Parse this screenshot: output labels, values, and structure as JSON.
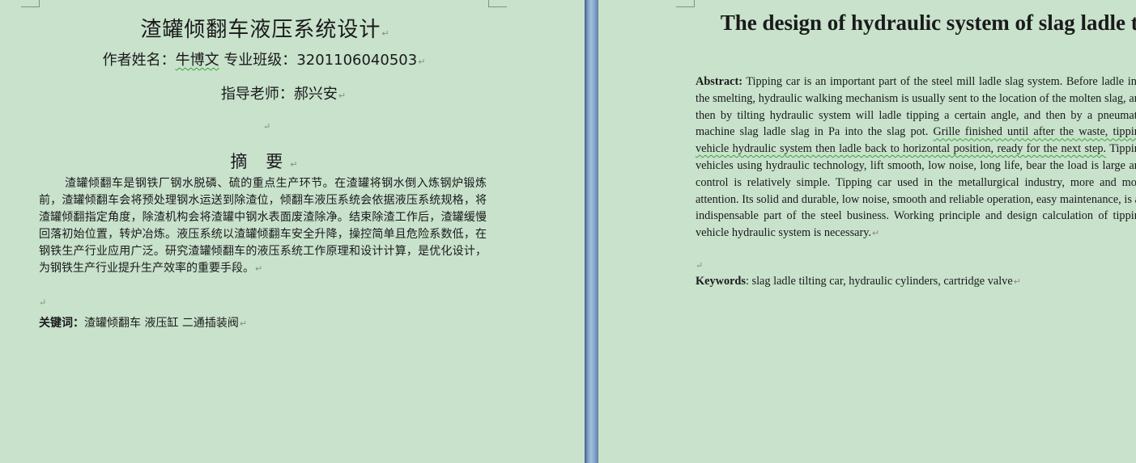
{
  "chinese_page": {
    "title": "渣罐倾翻车液压系统设计",
    "author_label": "作者姓名：",
    "author_name": "牛博文",
    "class_label": "专业班级：",
    "class_value": "3201106040503",
    "advisor_label": "指导老师：",
    "advisor_name": "郝兴安",
    "abstract_heading": "摘 要",
    "abstract_body": "渣罐倾翻车是钢铁厂钢水脱磷、硫的重点生产环节。在渣罐将钢水倒入炼钢炉锻炼前，渣罐倾翻车会将预处理钢水运送到除渣位，倾翻车液压系统会依据液压系统规格，将渣罐倾翻指定角度，除渣机构会将渣罐中钢水表面废渣除净。结束除渣工作后，渣罐缓慢回落初始位置，转炉冶炼。液压系统以渣罐倾翻车安全升降，操控简单且危险系数低，在钢铁生产行业应用广泛。研究渣罐倾翻车的液压系统工作原理和设计计算，是优化设计，为钢铁生产行业提升生产效率的重要手段。",
    "keywords_label": "关键词：",
    "keywords_value": "渣罐倾翻车 液压缸  二通插装阀"
  },
  "english_page": {
    "title": "The design of hydraulic system of slag ladle tilting car",
    "abstract_label": "Abstract:",
    "abstract_part1": "Tipping car is an important part of the steel mill ladle slag system. Before ladle into the smelting, hydraulic walking mechanism is usually sent to the location of the molten slag, and then by tilting hydraulic system will ladle tipping a certain angle, and then by a pneumatic machine slag ladle slag in Pa into the slag pot. ",
    "abstract_underlined": "Grille finished until after the waste, tipping vehicle hydraulic system then ladle back to horizontal position, ready for the next step.",
    "abstract_part2": " Tipping vehicles using hydraulic technology, lift smooth, low noise, long life, bear the load is large and control is relatively simple. Tipping car used in the metallurgical industry, more and more attention. Its solid and durable, low noise, smooth and reliable operation, easy maintenance, is an indispensable part of the steel business. Working principle and design calculation of tipping vehicle hydraulic system is necessary.",
    "keywords_label": "Keywords",
    "keywords_value": ": slag ladle tilting car, hydraulic cylinders, cartridge valve"
  },
  "marks": {
    "paragraph_mark": "↵"
  }
}
